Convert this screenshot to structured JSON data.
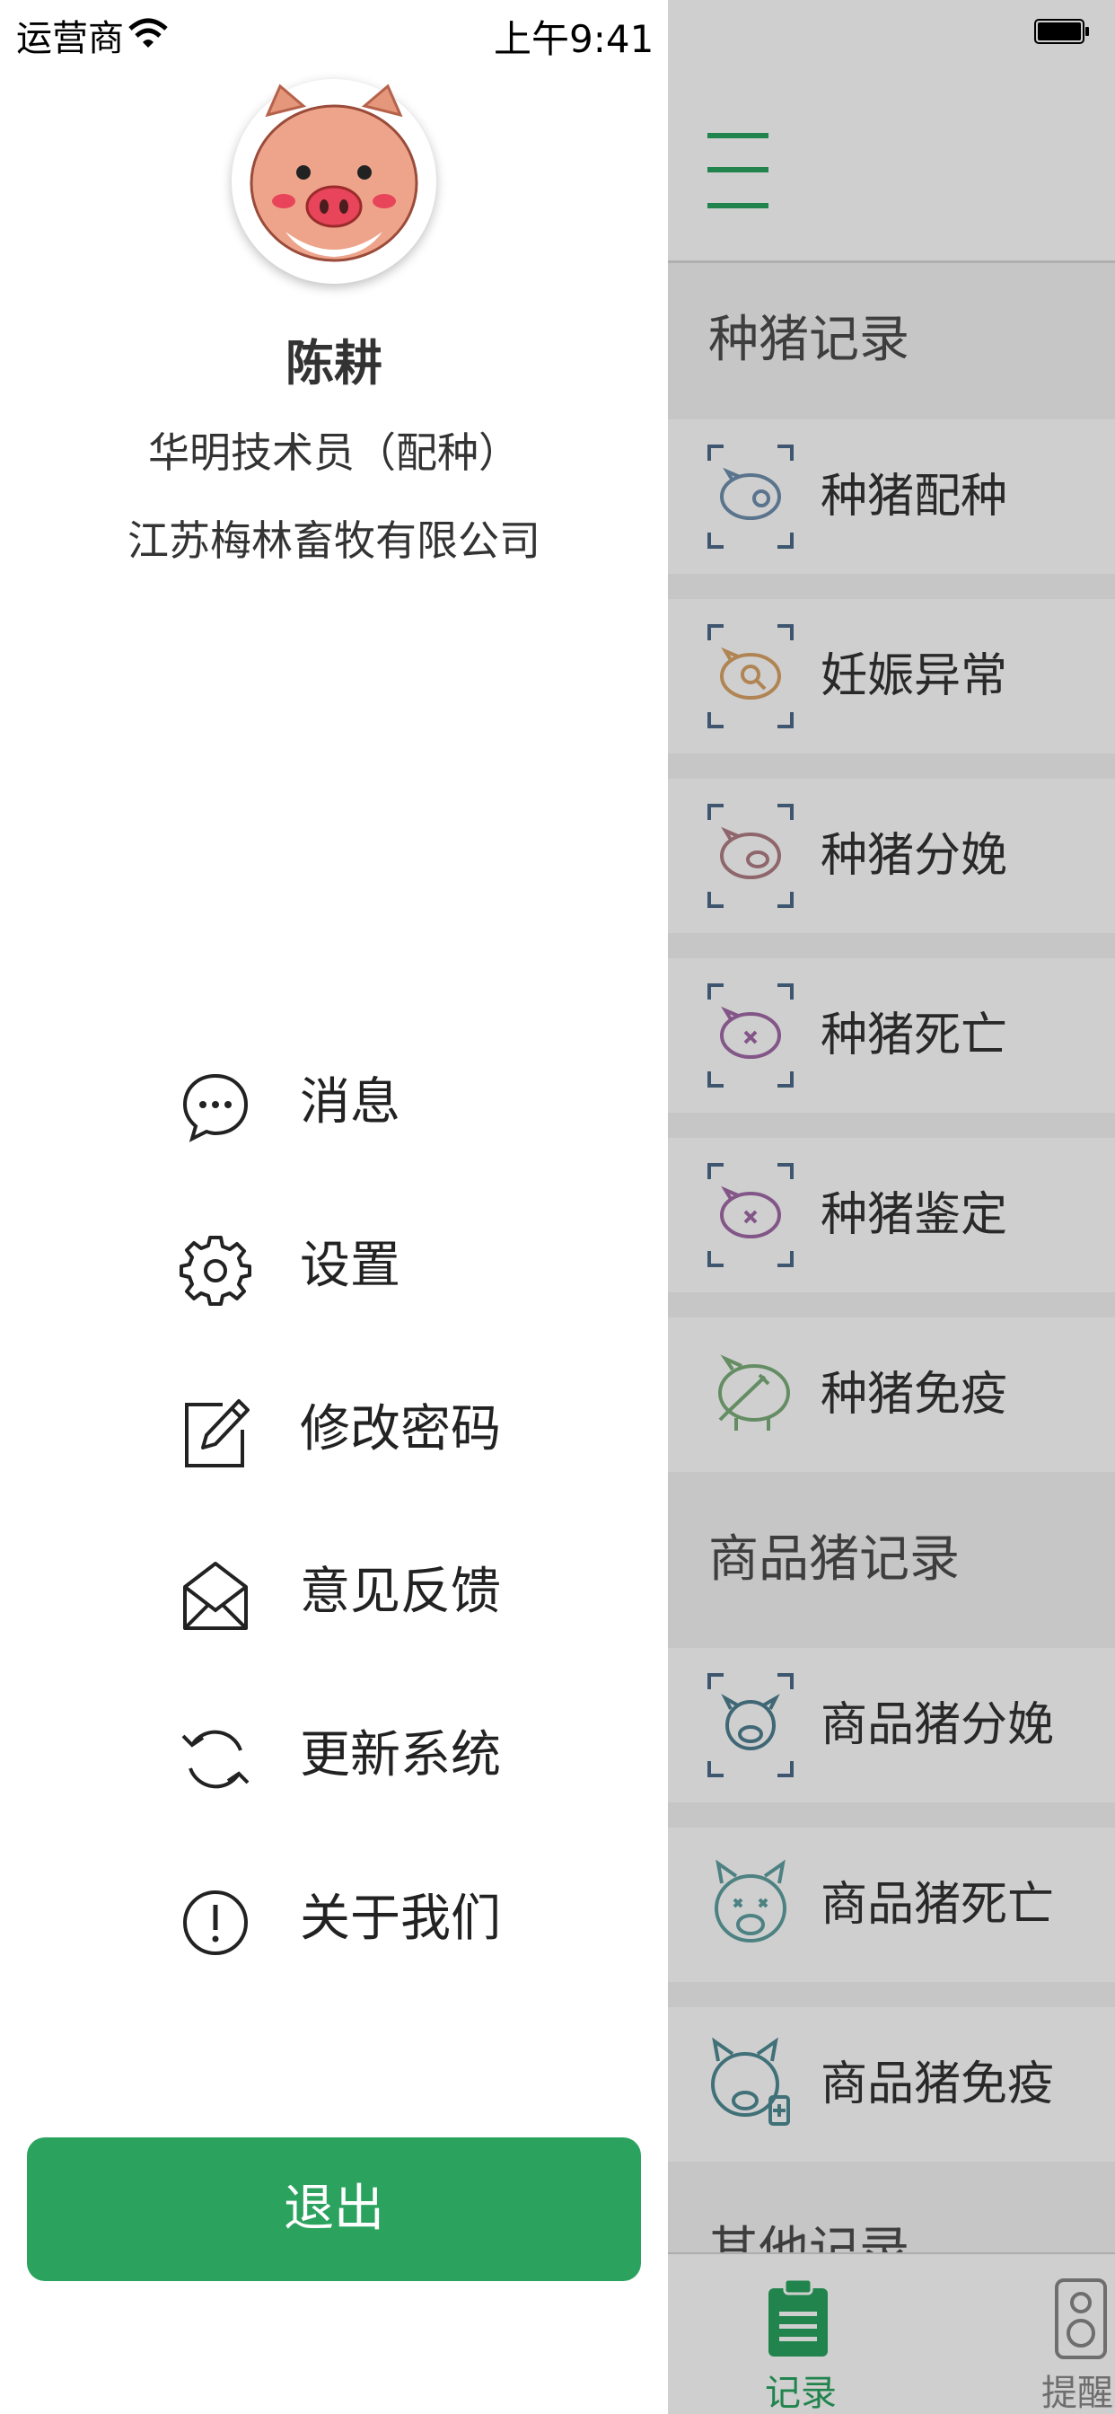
{
  "status_bar": {
    "carrier": "运营商",
    "time": "上午9:41"
  },
  "drawer": {
    "user": {
      "name": "陈耕",
      "role": "华明技术员（配种）",
      "company": "江苏梅林畜牧有限公司"
    },
    "menu": [
      {
        "label": "消息",
        "icon": "message-icon"
      },
      {
        "label": "设置",
        "icon": "gear-icon"
      },
      {
        "label": "修改密码",
        "icon": "edit-password-icon"
      },
      {
        "label": "意见反馈",
        "icon": "mail-icon"
      },
      {
        "label": "更新系统",
        "icon": "refresh-icon"
      },
      {
        "label": "关于我们",
        "icon": "info-icon"
      }
    ],
    "logout_label": "退出"
  },
  "main": {
    "sections": [
      {
        "title": "种猪记录",
        "items": [
          {
            "label": "种猪配种",
            "icon": "pig-breeding-icon",
            "color": "#6f8fae"
          },
          {
            "label": "妊娠异常",
            "icon": "pregnancy-abnormal-icon",
            "color": "#d9a467"
          },
          {
            "label": "种猪分娩",
            "icon": "pig-farrowing-icon",
            "color": "#b07e86"
          },
          {
            "label": "种猪死亡",
            "icon": "pig-death-icon",
            "color": "#a26aa8"
          },
          {
            "label": "种猪鉴定",
            "icon": "pig-appraisal-icon",
            "color": "#a26aa8"
          },
          {
            "label": "种猪免疫",
            "icon": "pig-vaccine-icon",
            "color": "#7cae7a"
          }
        ]
      },
      {
        "title": "商品猪记录",
        "items": [
          {
            "label": "商品猪分娩",
            "icon": "commercial-pig-farrowing-icon",
            "color": "#4f7f91"
          },
          {
            "label": "商品猪死亡",
            "icon": "commercial-pig-death-icon",
            "color": "#5f9fa0"
          },
          {
            "label": "商品猪免疫",
            "icon": "commercial-pig-vaccine-icon",
            "color": "#4f8b94"
          }
        ]
      },
      {
        "title": "其他记录",
        "items": []
      }
    ],
    "tabs": [
      {
        "label": "记录",
        "icon": "clipboard-icon",
        "active": true,
        "color": "#2ba35f"
      },
      {
        "label": "提醒",
        "icon": "speaker-icon",
        "active": false,
        "color": "#888888"
      }
    ]
  }
}
